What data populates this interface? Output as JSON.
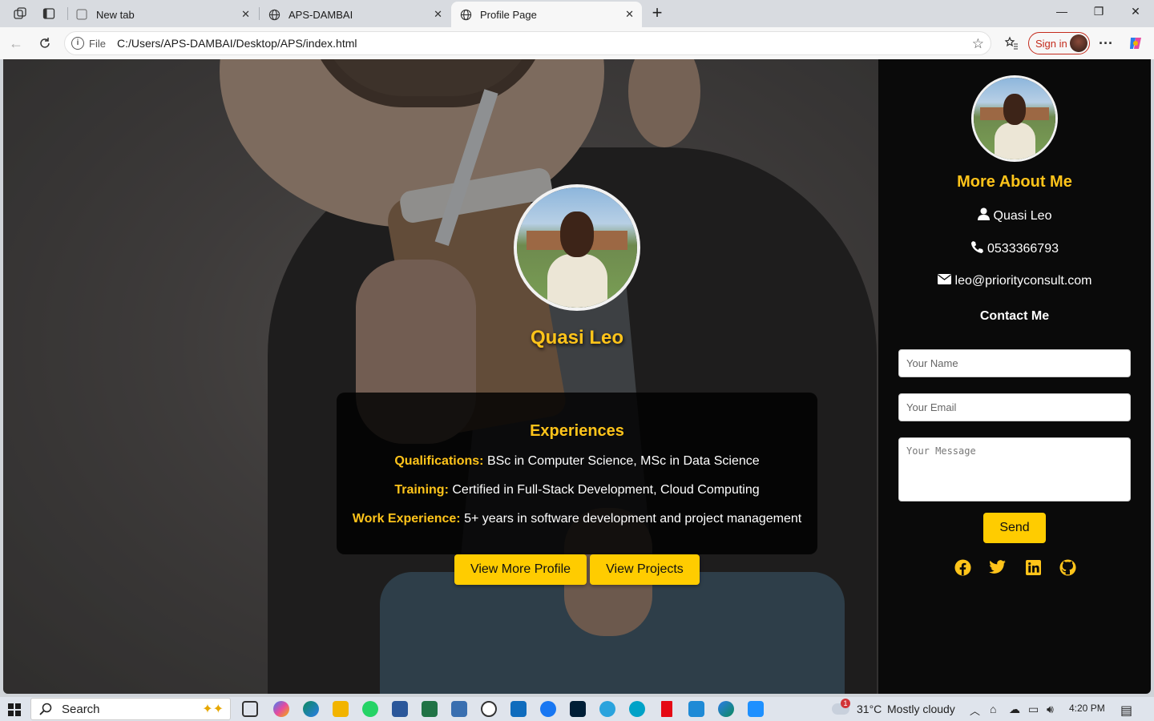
{
  "browser": {
    "tabs": [
      {
        "label": "New tab"
      },
      {
        "label": "APS-DAMBAI"
      },
      {
        "label": "Profile Page"
      }
    ],
    "address_prefix": "File",
    "url": "C:/Users/APS-DAMBAI/Desktop/APS/index.html",
    "signin_label": "Sign in"
  },
  "hero": {
    "name": "Quasi Leo",
    "experiences_title": "Experiences",
    "qualifications_label": "Qualifications:",
    "qualifications_value": "BSc in Computer Science, MSc in Data Science",
    "training_label": "Training:",
    "training_value": "Certified in Full-Stack Development, Cloud Computing",
    "work_label": "Work Experience:",
    "work_value": "5+ years in software development and project management",
    "btn_profile": "View More Profile",
    "btn_projects": "View Projects"
  },
  "sidebar": {
    "title": "More About Me",
    "name": "Quasi Leo",
    "phone": "0533366793",
    "email": "leo@priorityconsult.com",
    "contact_title": "Contact Me",
    "name_placeholder": "Your Name",
    "email_placeholder": "Your Email",
    "message_placeholder": "Your Message",
    "send_label": "Send",
    "socials": [
      "facebook-icon",
      "twitter-icon",
      "linkedin-icon",
      "github-icon"
    ],
    "accent_color": "#ffc41a"
  },
  "taskbar": {
    "search_label": "Search",
    "weather_badge": "1",
    "weather_temp": "31°C",
    "weather_desc": "Mostly cloudy",
    "time": "4:20 PM"
  }
}
